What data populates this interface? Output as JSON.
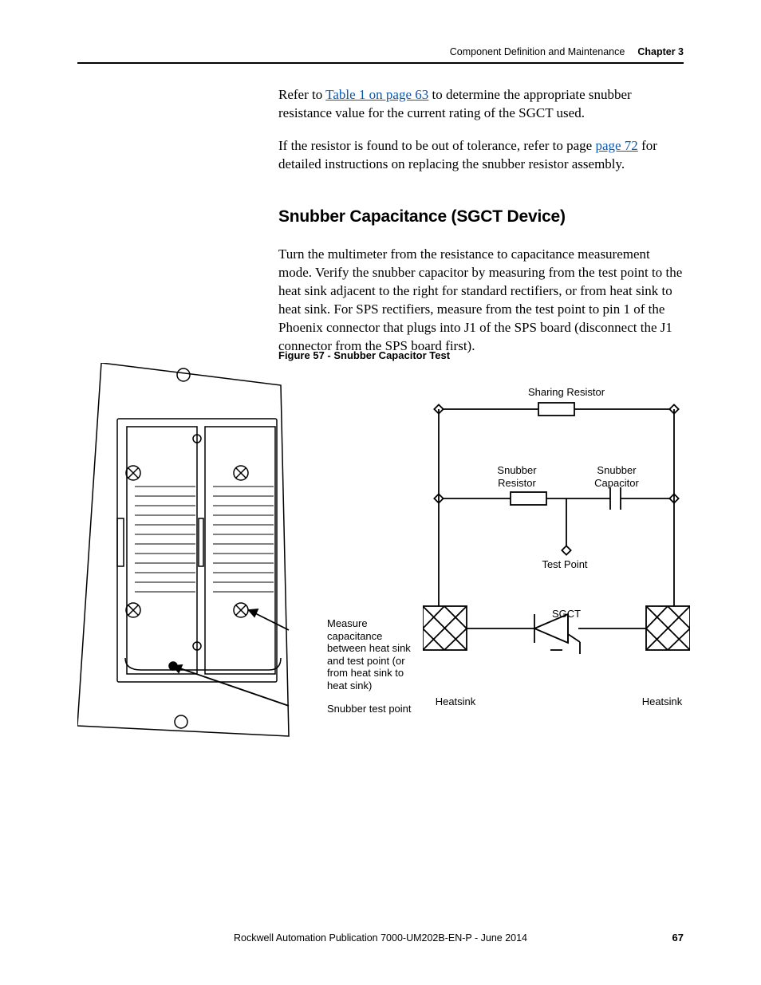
{
  "header": {
    "section": "Component Definition and Maintenance",
    "chapter": "Chapter 3"
  },
  "body": {
    "p1_pre": "Refer to ",
    "p1_link": "Table 1 on page 63",
    "p1_post": " to determine the appropriate snubber resistance value for the current rating of the SGCT used.",
    "p2_pre": "If the resistor is found to be out of tolerance, refer to page ",
    "p2_link": "page 72",
    "p2_post": " for detailed instructions on replacing the snubber resistor assembly.",
    "h2": "Snubber Capacitance (SGCT Device)",
    "p3": "Turn the multimeter from the resistance to capacitance measurement mode. Verify the snubber capacitor by measuring from the test point to the heat sink adjacent to the right for standard rectifiers, or from heat sink to heat sink. For SPS rectifiers, measure from the test point to pin 1 of the Phoenix connector that plugs into J1 of the SPS board (disconnect the J1 connector from the SPS board first)."
  },
  "figure": {
    "caption": "Figure 57 - Snubber Capacitor Test",
    "labels": {
      "measure": "Measure capacitance between heat sink and test point (or from heat sink to heat sink)",
      "snubber_test_point": "Snubber test point",
      "sharing_resistor": "Sharing Resistor",
      "snubber_resistor": "Snubber Resistor",
      "snubber_capacitor": "Snubber Capacitor",
      "test_point": "Test Point",
      "sgct": "SGCT",
      "heatsink_left": "Heatsink",
      "heatsink_right": "Heatsink"
    }
  },
  "footer": {
    "pub": "Rockwell Automation Publication 7000-UM202B-EN-P - June 2014",
    "page": "67"
  }
}
